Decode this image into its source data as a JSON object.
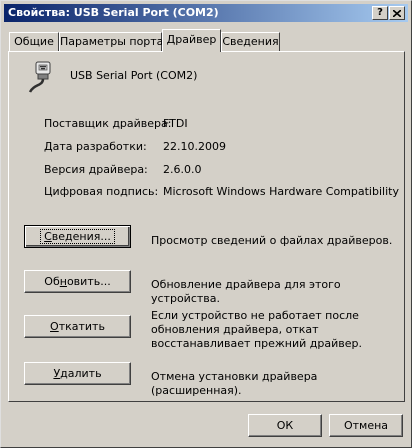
{
  "window": {
    "title": "Свойства: USB Serial Port (COM2)",
    "help_label": "?",
    "close_label": "X"
  },
  "tabs": [
    {
      "label": "Общие",
      "active": false
    },
    {
      "label": "Параметры порта",
      "active": false
    },
    {
      "label": "Драйвер",
      "active": true
    },
    {
      "label": "Сведения",
      "active": false
    }
  ],
  "device": {
    "name": "USB Serial Port (COM2)",
    "icon": "serial-port-icon"
  },
  "info": {
    "provider_label": "Поставщик драйвера:",
    "provider_value": "FTDI",
    "date_label": "Дата разработки:",
    "date_value": "22.10.2009",
    "version_label": "Версия драйвера:",
    "version_value": "2.6.0.0",
    "signature_label": "Цифровая подпись:",
    "signature_value": "Microsoft Windows Hardware Compatibility Publ"
  },
  "actions": {
    "details": {
      "label": "Сведения...",
      "underline": "С",
      "rest": "ведения...",
      "desc": "Просмотр сведений о файлах драйверов."
    },
    "update": {
      "label": "Обновить...",
      "pre": "Об",
      "underline": "н",
      "rest": "овить...",
      "desc": "Обновление драйвера для этого устройства."
    },
    "rollback": {
      "label": "Откатить",
      "underline": "О",
      "rest": "ткатить",
      "desc_line1": "Если устройство не работает после",
      "desc_line2": "обновления драйвера, откат",
      "desc_line3": "восстанавливает прежний драйвер."
    },
    "uninstall": {
      "label": "Удалить",
      "underline": "У",
      "rest": "далить",
      "desc": "Отмена установки драйвера (расширенная)."
    }
  },
  "footer": {
    "ok_label": "ОК",
    "cancel_label": "Отмена"
  }
}
